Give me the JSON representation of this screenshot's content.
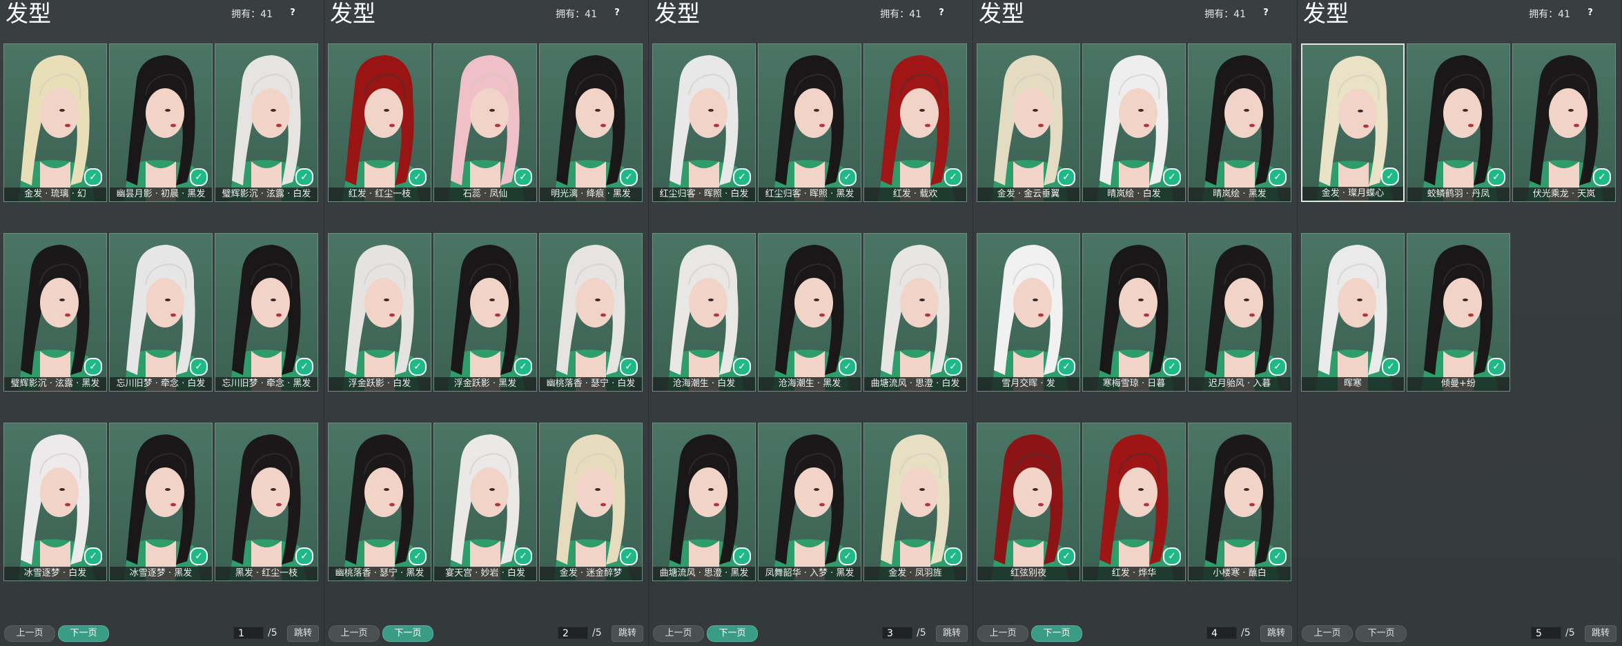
{
  "colors": {
    "background": "#34393b",
    "card_bg": "#41695b",
    "card_border": "#6f8f83",
    "check_badge": "#1fb987",
    "active_button": "#3b9c85"
  },
  "icons": {
    "owned_check": "checkmark-badge-icon",
    "help": "question-icon"
  },
  "panels": [
    {
      "title": "发型",
      "owned": "拥有：41",
      "help": "?",
      "items": [
        {
          "name": "金发 · 琉璃 · 幻",
          "hair": "#e8dfb8",
          "dark": false
        },
        {
          "name": "幽昙月影 · 初晨 · 黑发",
          "hair": "#1a1718",
          "dark": true
        },
        {
          "name": "璧辉影沉 · 泫露 · 白发",
          "hair": "#e6e4e2",
          "dark": false
        },
        {
          "name": "璧辉影沉 · 泫露 · 黑发",
          "hair": "#1b1819",
          "dark": true
        },
        {
          "name": "忘川旧梦 · 牵念 · 白发",
          "hair": "#e7e6e6",
          "dark": false
        },
        {
          "name": "忘川旧梦 · 牵念 · 黑发",
          "hair": "#1a1718",
          "dark": true
        },
        {
          "name": "冰雪逐梦 · 白发",
          "hair": "#eceaea",
          "dark": false
        },
        {
          "name": "冰雪逐梦 · 黑发",
          "hair": "#1a1718",
          "dark": true
        },
        {
          "name": "黑发 · 红尘一枝",
          "hair": "#1c1819",
          "dark": true
        }
      ],
      "pager": {
        "prev": "上一页",
        "next": "下一页",
        "page": "1",
        "total": "/5",
        "jump": "跳转",
        "active": "next"
      }
    },
    {
      "title": "发型",
      "owned": "拥有：41",
      "help": "?",
      "items": [
        {
          "name": "红发 · 红尘一枝",
          "hair": "#9a1414",
          "dark": true
        },
        {
          "name": "石蕊 · 凤仙",
          "hair": "#efc0c8",
          "dark": false
        },
        {
          "name": "明光漓 · 绛痕 · 黑发",
          "hair": "#1a1718",
          "dark": true
        },
        {
          "name": "浮金跃影 · 白发",
          "hair": "#e5e3e2",
          "dark": false
        },
        {
          "name": "浮金跃影 · 黑发",
          "hair": "#1a1718",
          "dark": true
        },
        {
          "name": "幽桃落香 · 瑟宁 · 白发",
          "hair": "#e6e4e2",
          "dark": false
        },
        {
          "name": "幽桃落香 · 瑟宁 · 黑发",
          "hair": "#1b1819",
          "dark": true
        },
        {
          "name": "宴天宫 · 妙岩 · 白发",
          "hair": "#ebe9e8",
          "dark": false
        },
        {
          "name": "金发 · 迷金醉梦",
          "hair": "#e6dcbd",
          "dark": false
        }
      ],
      "pager": {
        "prev": "上一页",
        "next": "下一页",
        "page": "2",
        "total": "/5",
        "jump": "跳转",
        "active": "next"
      }
    },
    {
      "title": "发型",
      "owned": "拥有：41",
      "help": "?",
      "items": [
        {
          "name": "红尘归客 · 晖照 · 白发",
          "hair": "#e9e8e8",
          "dark": false
        },
        {
          "name": "红尘归客 · 晖照 · 黑发",
          "hair": "#1a1718",
          "dark": true
        },
        {
          "name": "红发 · 载欢",
          "hair": "#a01616",
          "dark": true
        },
        {
          "name": "沧海潮生 · 白发",
          "hair": "#e8e7e6",
          "dark": false
        },
        {
          "name": "沧海潮生 · 黑发",
          "hair": "#1a1718",
          "dark": true
        },
        {
          "name": "曲塘流风 · 思澄 · 白发",
          "hair": "#e7e6e5",
          "dark": false
        },
        {
          "name": "曲塘流风 · 思澄 · 黑发",
          "hair": "#1a1718",
          "dark": true
        },
        {
          "name": "凤舞韶华 · 入梦 · 黑发",
          "hair": "#1b1819",
          "dark": true
        },
        {
          "name": "金发 · 凤羽旌",
          "hair": "#e7dfc4",
          "dark": false
        }
      ],
      "pager": {
        "prev": "上一页",
        "next": "下一页",
        "page": "3",
        "total": "/5",
        "jump": "跳转",
        "active": "next"
      }
    },
    {
      "title": "发型",
      "owned": "拥有：41",
      "help": "?",
      "items": [
        {
          "name": "金发 · 金云垂翼",
          "hair": "#e3dcc2",
          "dark": false
        },
        {
          "name": "晴岚绘 · 白发",
          "hair": "#efeeee",
          "dark": false
        },
        {
          "name": "晴岚绘 · 黑发",
          "hair": "#1a1718",
          "dark": true
        },
        {
          "name": "雪月交晖 · 发",
          "hair": "#f1f1f2",
          "dark": false
        },
        {
          "name": "寒梅雪琼 · 日暮",
          "hair": "#1a1718",
          "dark": true
        },
        {
          "name": "迟月骀风 · 入暮",
          "hair": "#1b1819",
          "dark": true
        },
        {
          "name": "红弦别夜",
          "hair": "#8c1414",
          "dark": true
        },
        {
          "name": "红发 · 烨华",
          "hair": "#9d1515",
          "dark": true
        },
        {
          "name": "小楼寒 · 蘸白",
          "hair": "#1b1819",
          "dark": true
        }
      ],
      "pager": {
        "prev": "上一页",
        "next": "下一页",
        "page": "4",
        "total": "/5",
        "jump": "跳转",
        "active": "next"
      }
    },
    {
      "title": "发型",
      "owned": "拥有：41",
      "help": "?",
      "items": [
        {
          "name": "金发 · 璨月蝶心",
          "hair": "#e9e2c6",
          "dark": false,
          "selected": true
        },
        {
          "name": "蛟鳞鹤羽 · 丹凤",
          "hair": "#1a1718",
          "dark": true
        },
        {
          "name": "伏光乘龙 · 天岚",
          "hair": "#1b1819",
          "dark": true
        },
        {
          "name": "晖寒",
          "hair": "#ebeaea",
          "dark": false
        },
        {
          "name": "倾曼+纷",
          "hair": "#1a1718",
          "dark": true
        }
      ],
      "pager": {
        "prev": "上一页",
        "next": "下一页",
        "page": "5",
        "total": "/5",
        "jump": "跳转",
        "active": "none"
      }
    }
  ]
}
